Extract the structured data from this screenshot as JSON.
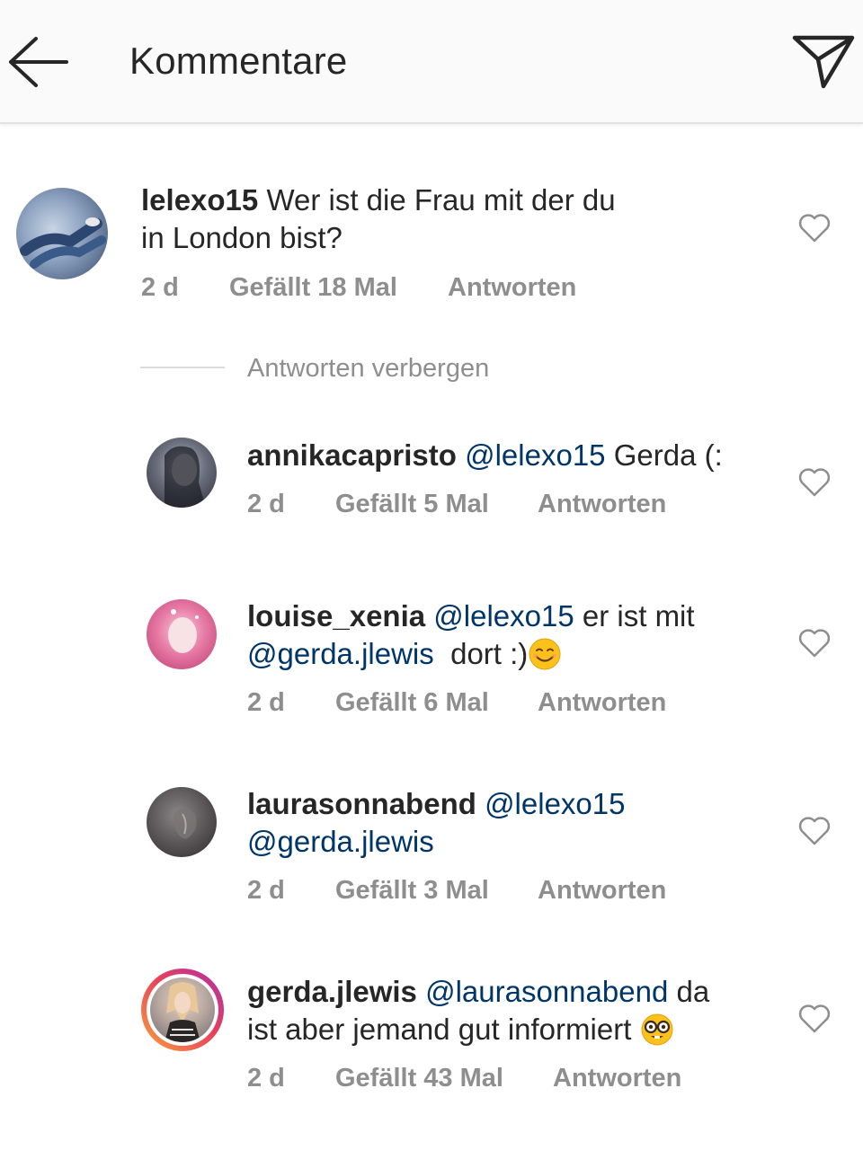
{
  "header": {
    "title": "Kommentare",
    "back_icon": "arrow-left-icon",
    "send_icon": "paper-plane-icon"
  },
  "main_comment": {
    "username": "lelexo15",
    "text_line1": "Wer ist die Frau mit der du",
    "text_line2": "in London bist?",
    "age": "2 d",
    "likes": "Gefällt 18 Mal",
    "reply": "Antworten"
  },
  "hide_replies": "Antworten verbergen",
  "replies": [
    {
      "username": "annikacapristo",
      "mention": "@lelexo15",
      "text": "Gerda (:",
      "age": "2 d",
      "likes": "Gefällt 5 Mal",
      "reply": "Antworten"
    },
    {
      "username": "louise_xenia",
      "mention": "@lelexo15",
      "text": "er ist mit",
      "mention2": "@gerda.jlewis",
      "text2": "dort :)",
      "emoji": "smiling-face-emoji",
      "age": "2 d",
      "likes": "Gefällt 6 Mal",
      "reply": "Antworten"
    },
    {
      "username": "laurasonnabend",
      "mention": "@lelexo15",
      "mention2": "@gerda.jlewis",
      "age": "2 d",
      "likes": "Gefällt 3 Mal",
      "reply": "Antworten"
    },
    {
      "username": "gerda.jlewis",
      "mention": "@laurasonnabend",
      "text": "da",
      "text2": "ist aber jemand gut informiert",
      "emoji": "nerd-face-emoji",
      "age": "2 d",
      "likes": "Gefällt 43 Mal",
      "reply": "Antworten"
    }
  ],
  "colors": {
    "mention": "#003569",
    "meta": "#8e8e8e",
    "text": "#262626"
  }
}
